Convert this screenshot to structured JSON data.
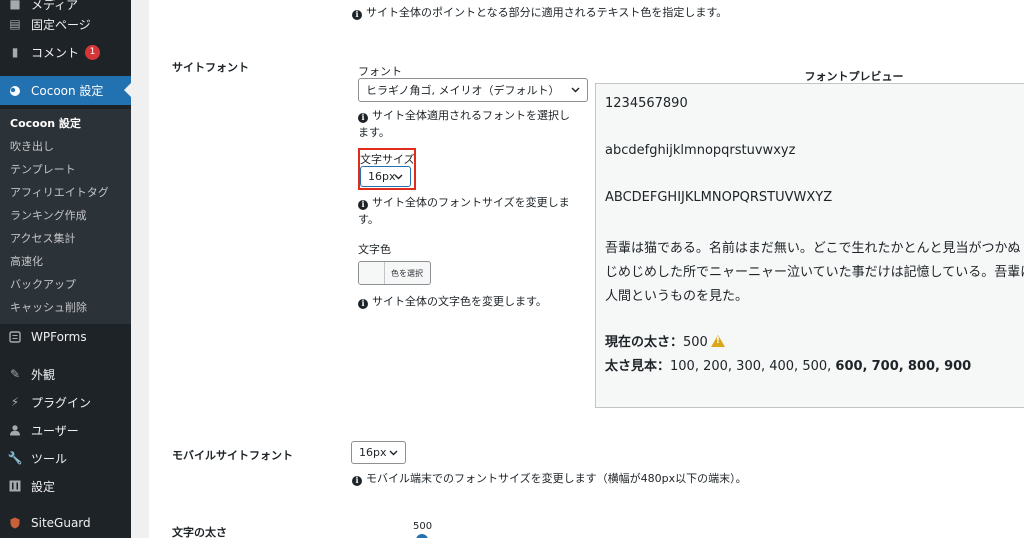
{
  "sidebar": {
    "top_partial": "メディア",
    "items": [
      {
        "label": "固定ページ",
        "icon": "page-icon"
      },
      {
        "label": "コメント",
        "icon": "comment-icon",
        "badge": "1"
      },
      {
        "label": "Cocoon 設定",
        "icon": "cocoon-icon"
      }
    ],
    "submenu": [
      "Cocoon 設定",
      "吹き出し",
      "テンプレート",
      "アフィリエイトタグ",
      "ランキング作成",
      "アクセス集計",
      "高速化",
      "バックアップ",
      "キャッシュ削除"
    ],
    "items2": [
      {
        "label": "WPForms",
        "icon": "wpforms-icon"
      },
      {
        "label": "外観",
        "icon": "appearance-icon"
      },
      {
        "label": "プラグイン",
        "icon": "plugin-icon"
      },
      {
        "label": "ユーザー",
        "icon": "user-icon"
      },
      {
        "label": "ツール",
        "icon": "tools-icon"
      },
      {
        "label": "設定",
        "icon": "settings-icon"
      },
      {
        "label": "SiteGuard",
        "icon": "siteguard-icon"
      }
    ]
  },
  "main": {
    "top_note": "サイト全体のポイントとなる部分に適用されるテキスト色を指定します。",
    "site_font": {
      "label": "サイトフォント",
      "font_label": "フォント",
      "font_value": "ヒラギノ角ゴ, メイリオ（デフォルト）",
      "font_note_line1": "サイト全体適用されるフォントを選択し",
      "font_note_line2": "ます。",
      "size_label": "文字サイズ",
      "size_value": "16px",
      "size_note_line1": "サイト全体のフォントサイズを変更しま",
      "size_note_line2": "す。",
      "color_label": "文字色",
      "color_button": "色を選択",
      "color_note": "サイト全体の文字色を変更します。"
    },
    "preview": {
      "title": "フォントプレビュー",
      "digits": "1234567890",
      "lower": "abcdefghijklmnopqrstuvwxyz",
      "upper": "ABCDEFGHIJKLMNOPQRSTUVWXYZ",
      "jp_line1": "吾輩は猫である。名前はまだ無い。どこで生れたかとんと見当がつかぬ",
      "jp_line2": "じめじめした所でニャーニャー泣いていた事だけは記憶している。吾輩は",
      "jp_line3": "人間というものを見た。",
      "weight_label": "現在の太さ：",
      "weight_value": "500",
      "sample_label": "太さ見本：",
      "sample_light": "100, 200, 300, 400, 500,",
      "sample_600": "600,",
      "sample_700": "700,",
      "sample_800": "800,",
      "sample_900": "900"
    },
    "mobile_font": {
      "label": "モバイルサイトフォント",
      "size_value": "16px",
      "note": "モバイル端末でのフォントサイズを変更します（横幅が480px以下の端末）。"
    },
    "weight": {
      "label": "文字の太さ",
      "value": "500"
    }
  },
  "colors": {
    "sidebar_bg": "#1d2327",
    "submenu_bg": "#2c3338",
    "active_bg": "#2271b1",
    "badge": "#d63638",
    "highlight_box": "#e02d1b",
    "warning": "#dba617"
  }
}
